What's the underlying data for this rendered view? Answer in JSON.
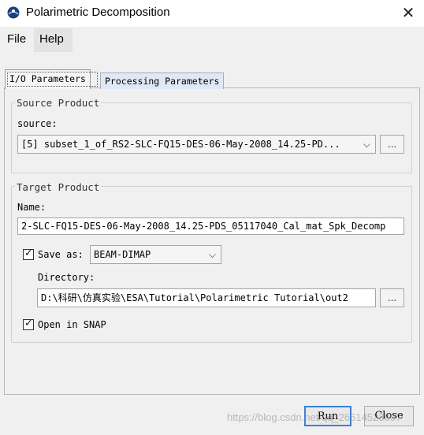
{
  "window": {
    "title": "Polarimetric Decomposition",
    "close_glyph": "✕",
    "app_icon": "snap-app-icon"
  },
  "menu": {
    "items": [
      "File",
      "Help"
    ]
  },
  "tabs": [
    {
      "label": "I/O Parameters",
      "selected": true
    },
    {
      "label": "Processing Parameters",
      "selected": false
    }
  ],
  "source_product": {
    "group_title": "Source Product",
    "source_label": "source:",
    "selected_value": "[5] subset_1_of_RS2-SLC-FQ15-DES-06-May-2008_14.25-PD...",
    "browse_label": "..."
  },
  "target_product": {
    "group_title": "Target Product",
    "name_label": "Name:",
    "name_value": "2-SLC-FQ15-DES-06-May-2008_14.25-PDS_05117040_Cal_mat_Spk_Decomp",
    "save_as_label": "Save as:",
    "save_as_checked": true,
    "format_value": "BEAM-DIMAP",
    "directory_label": "Directory:",
    "directory_value": "D:\\科研\\仿真实验\\ESA\\Tutorial\\Polarimetric Tutorial\\out2",
    "browse_label": "...",
    "open_in_snap_label": "Open in SNAP",
    "open_in_snap_checked": true
  },
  "footer": {
    "run_label": "Run",
    "close_label": "Close"
  },
  "watermark": "https://blog.csdn.net/qq_26514523007"
}
